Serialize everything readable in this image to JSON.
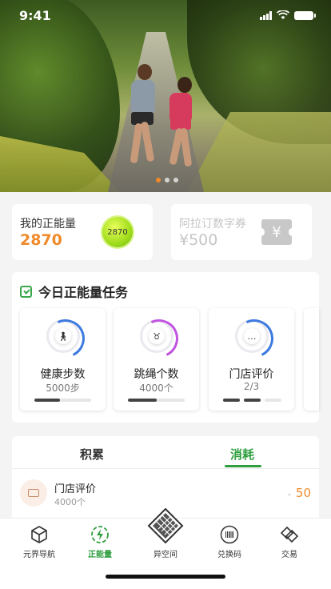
{
  "status_bar": {
    "time": "9:41"
  },
  "banner": {
    "dots": 3,
    "active_dot": 0
  },
  "energy": {
    "label": "我的正能量",
    "value": "2870",
    "badge": "2870"
  },
  "coupon": {
    "label": "阿拉订数字券",
    "value": "¥500",
    "icon": "yen-ticket-icon"
  },
  "tasks": {
    "title": "今日正能量任务",
    "items": [
      {
        "name": "健康步数",
        "sub": "5000步",
        "icon": "walk-icon",
        "progress": 0.45,
        "ring_color": "#3d7be0"
      },
      {
        "name": "跳绳个数",
        "sub": "4000个",
        "icon": "jump-rope-icon",
        "progress": 0.5,
        "ring_color": "#c255e0"
      },
      {
        "name": "门店评价",
        "sub": "2/3",
        "icon": "chat-icon",
        "done": 2,
        "total": 3,
        "ring_color": "#3d7be0"
      }
    ]
  },
  "record_tabs": {
    "tabs": [
      {
        "label": "积累"
      },
      {
        "label": "消耗"
      }
    ],
    "active": 1,
    "record": {
      "name": "门店评价",
      "sub": "4000个",
      "minus": "-",
      "amount": "50"
    }
  },
  "nav": {
    "items": [
      {
        "label": "元界导航",
        "icon": "cube-icon"
      },
      {
        "label": "正能量",
        "icon": "energy-icon"
      },
      {
        "label": "异空间",
        "icon": "diamond-grid-icon"
      },
      {
        "label": "兑换码",
        "icon": "barcode-icon"
      },
      {
        "label": "交易",
        "icon": "trade-icon"
      }
    ],
    "active": 1
  },
  "colors": {
    "accent": "#2e9e3e",
    "orange": "#f08a2a"
  }
}
